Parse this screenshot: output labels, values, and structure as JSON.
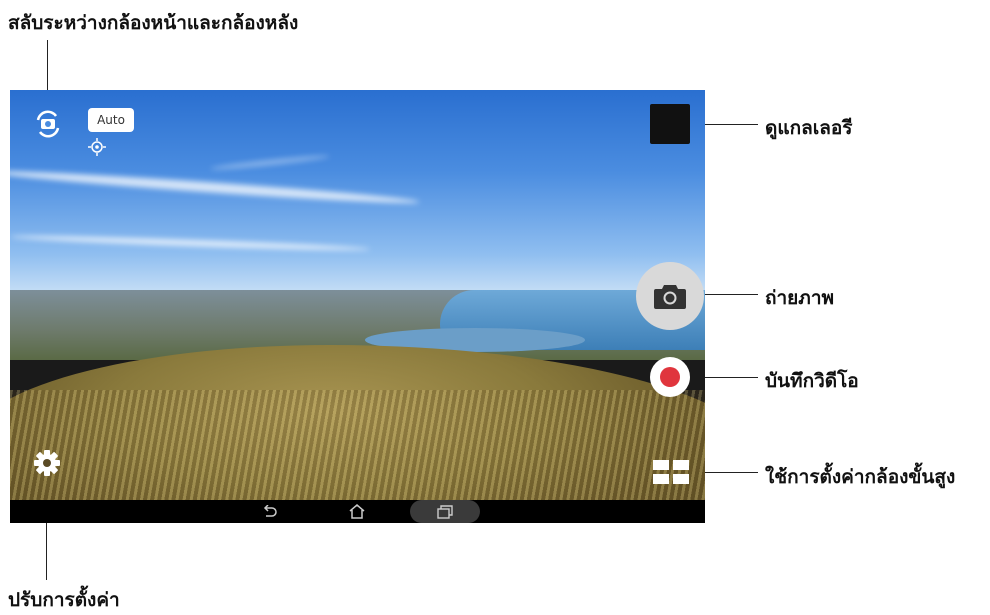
{
  "annotations": {
    "switch_camera": "สลับระหว่างกล้องหน้าและกล้องหลัง",
    "gallery": "ดูแกลเลอรี",
    "capture": "ถ่ายภาพ",
    "record_video": "บันทึกวิดีโอ",
    "advanced_settings": "ใช้การตั้งค่ากล้องขั้นสูง",
    "settings": "ปรับการตั้งค่า"
  },
  "camera_ui": {
    "scene_mode": "Auto"
  },
  "icons": {
    "switch": "switch-camera-icon",
    "focus": "focus-icon",
    "capture": "camera-icon",
    "record": "record-icon",
    "settings": "gear-icon",
    "advanced": "grid-icon",
    "back": "back-icon",
    "home": "home-icon",
    "recent": "recent-apps-icon"
  },
  "colors": {
    "record": "#e0353d",
    "navbar": "#000000"
  }
}
